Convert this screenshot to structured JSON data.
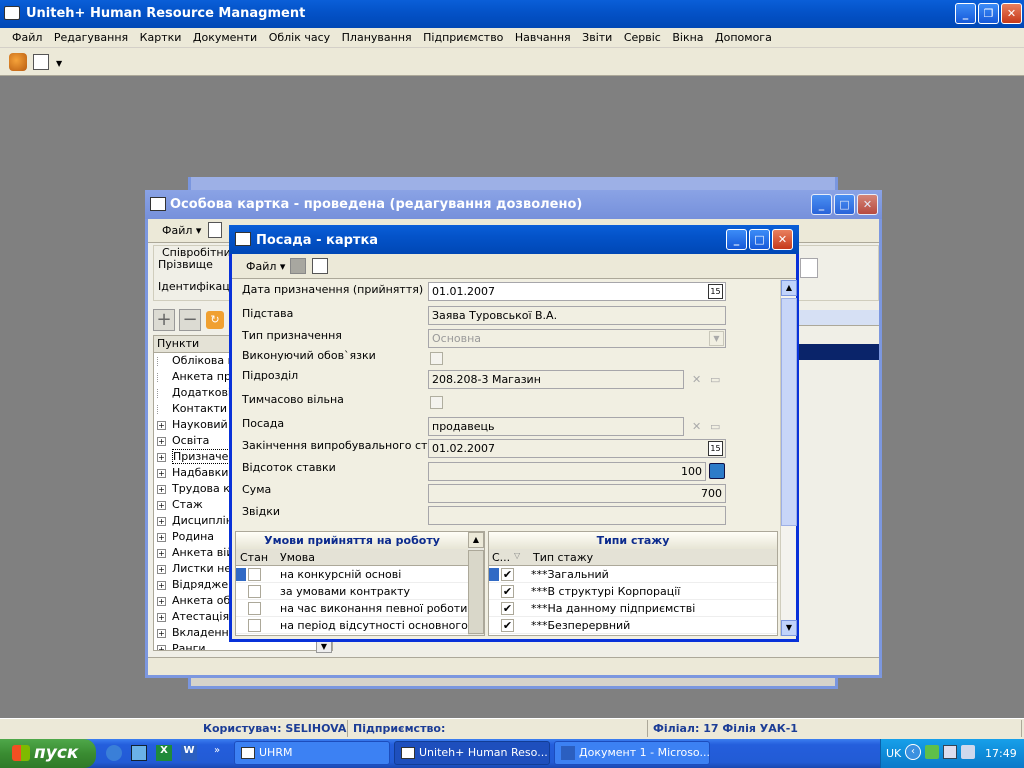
{
  "app": {
    "title": "Uniteh+ Human Resource Managment"
  },
  "menu": [
    "Файл",
    "Редагування",
    "Картки",
    "Документи",
    "Облік часу",
    "Планування",
    "Підприємство",
    "Навчання",
    "Звіти",
    "Сервіс",
    "Вікна",
    "Допомога"
  ],
  "personal_card": {
    "title": "Особова картка - проведена (редагування дозволено)",
    "file_menu": "Файл",
    "section_employee": "Співробітник",
    "label_surname": "Прізвище",
    "label_id": "Ідентифікаційн",
    "tree_header": "Пункти",
    "tree_items": [
      {
        "label": "Облікова ка",
        "expand": false
      },
      {
        "label": "Анкета праці",
        "expand": false
      },
      {
        "label": "Додаткові а",
        "expand": false
      },
      {
        "label": "Контакти",
        "expand": false
      },
      {
        "label": "Науковий ст",
        "expand": true
      },
      {
        "label": "Освіта",
        "expand": true
      },
      {
        "label": "Призначенн",
        "expand": true
      },
      {
        "label": "Надбавки",
        "expand": true
      },
      {
        "label": "Трудова кни",
        "expand": true
      },
      {
        "label": "Стаж",
        "expand": true
      },
      {
        "label": "Дисциплінар",
        "expand": true
      },
      {
        "label": "Родина",
        "expand": true
      },
      {
        "label": "Анкета війсь",
        "expand": true
      },
      {
        "label": "Листки непр",
        "expand": true
      },
      {
        "label": "Відрядження",
        "expand": true
      },
      {
        "label": "Анкета обме",
        "expand": true
      },
      {
        "label": "Атестація",
        "expand": true
      },
      {
        "label": "Вкладення",
        "expand": true
      },
      {
        "label": "Ранги",
        "expand": true
      }
    ]
  },
  "position_card": {
    "title": "Посада - картка",
    "file_menu": "Файл",
    "labels": {
      "date": "Дата призначення (прийняття)",
      "basis": "Підстава",
      "type": "Тип призначення",
      "acting": "Виконуючий обов`язки",
      "department": "Підрозділ",
      "temp_vacant": "Тимчасово вільна",
      "position": "Посада",
      "probation_end": "Закінчення випробувального строку",
      "rate_percent": "Відсоток ставки",
      "sum": "Сума",
      "source": "Звідки"
    },
    "values": {
      "date": "01.01.2007",
      "basis": "Заява Туровської В.А.",
      "type": "Основна",
      "department": "208.208-3   Магазин",
      "position": "продавець",
      "probation_end": "01.02.2007",
      "rate_percent": "100",
      "sum": "700",
      "source": ""
    },
    "conditions": {
      "title": "Умови прийняття на роботу",
      "col_state": "Стан",
      "col_condition": "Умова",
      "rows": [
        "на конкурсній основі",
        "за умовами контракту",
        "на час виконання певної роботи",
        "на період відсутності основного прац"
      ]
    },
    "seniority": {
      "title": "Типи стажу",
      "col_c": "С...",
      "col_type": "Тип стажу",
      "rows": [
        "***Загальний",
        "***В структурі Корпорації",
        "***На данному підприємстві",
        "***Безперервний"
      ]
    }
  },
  "statusbar": {
    "user": "Користувач: SELIHOVA",
    "enterprise": "Підприємство:",
    "branch": "Філіал: 17 Філія УАК-1"
  },
  "taskbar": {
    "start": "пуск",
    "tasks": [
      "UHRM",
      "Uniteh+ Human Reso...",
      "Документ 1 - Microso..."
    ],
    "lang": "UK",
    "clock": "17:49"
  }
}
